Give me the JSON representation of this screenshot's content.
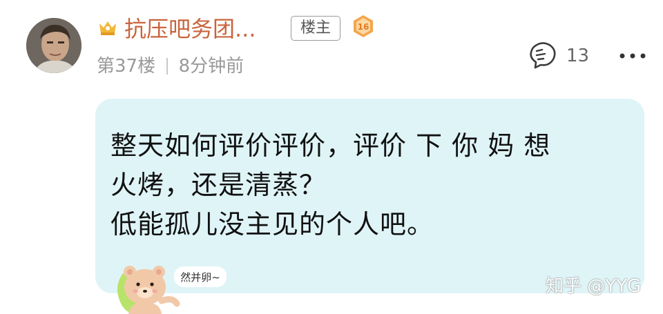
{
  "post": {
    "username": "抗压吧务团...",
    "owner_badge": "楼主",
    "level": "16",
    "floor": "第37楼",
    "time": "8分钟前",
    "reply_count": "13",
    "content_lines": [
      "整天如何评价评价，评价 下 你 妈 想",
      "火烤，还是清蒸？",
      "低能孤儿没主见的个人吧。"
    ],
    "sticker_text": "然并卵~"
  },
  "watermark": "知乎 @YYG",
  "icons": {
    "crown": "crown-icon",
    "level": "level-badge-icon",
    "reply": "reply-icon",
    "more": "more-icon"
  },
  "colors": {
    "username": "#c8643c",
    "bubble": "#dff4f7",
    "meta": "#999999"
  }
}
